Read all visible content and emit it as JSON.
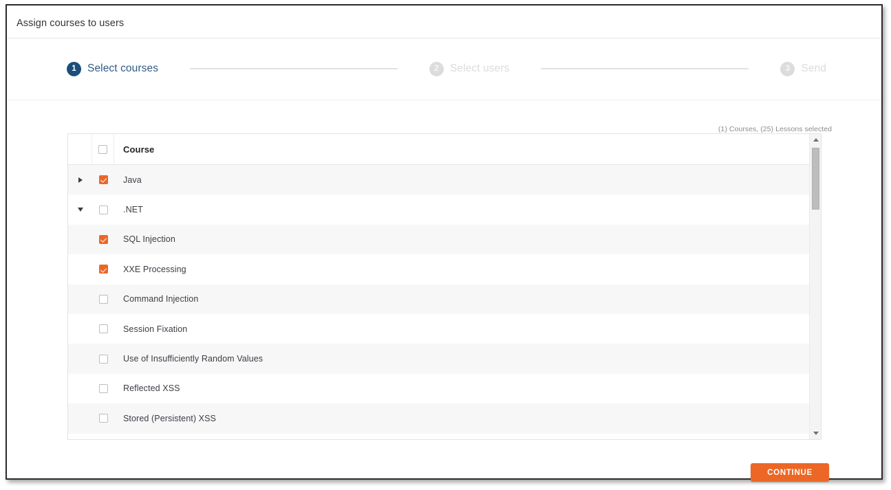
{
  "header": {
    "title": "Assign courses to users"
  },
  "stepper": {
    "steps": [
      {
        "number": "1",
        "label": "Select courses",
        "state": "active"
      },
      {
        "number": "2",
        "label": "Select users",
        "state": "inactive"
      },
      {
        "number": "3",
        "label": "Send",
        "state": "inactive"
      }
    ]
  },
  "selection_summary": "(1) Courses, (25) Lessons selected",
  "table": {
    "header": {
      "select_all_checked": false,
      "column_label": "Course"
    },
    "rows": [
      {
        "label": "Java",
        "checked": true,
        "type": "course",
        "expander": "collapsed",
        "stripe": "alt"
      },
      {
        "label": ".NET",
        "checked": false,
        "type": "course",
        "expander": "expanded",
        "stripe": "plain"
      },
      {
        "label": "SQL Injection",
        "checked": true,
        "type": "lesson",
        "expander": "none",
        "stripe": "alt"
      },
      {
        "label": "XXE Processing",
        "checked": true,
        "type": "lesson",
        "expander": "none",
        "stripe": "plain"
      },
      {
        "label": "Command Injection",
        "checked": false,
        "type": "lesson",
        "expander": "none",
        "stripe": "alt"
      },
      {
        "label": "Session Fixation",
        "checked": false,
        "type": "lesson",
        "expander": "none",
        "stripe": "plain"
      },
      {
        "label": "Use of Insufficiently Random Values",
        "checked": false,
        "type": "lesson",
        "expander": "none",
        "stripe": "alt"
      },
      {
        "label": "Reflected XSS",
        "checked": false,
        "type": "lesson",
        "expander": "none",
        "stripe": "plain"
      },
      {
        "label": "Stored (Persistent) XSS",
        "checked": false,
        "type": "lesson",
        "expander": "none",
        "stripe": "alt"
      },
      {
        "label": "",
        "checked": false,
        "type": "lesson",
        "expander": "none",
        "stripe": "plain"
      }
    ]
  },
  "footer": {
    "continue_label": "CONTINUE"
  },
  "colors": {
    "accent_orange": "#ec6726",
    "step_active_blue": "#1c4e7c",
    "step_label_blue": "#2f5b85",
    "row_stripe": "#f7f7f7",
    "border": "#e3e3e3"
  }
}
